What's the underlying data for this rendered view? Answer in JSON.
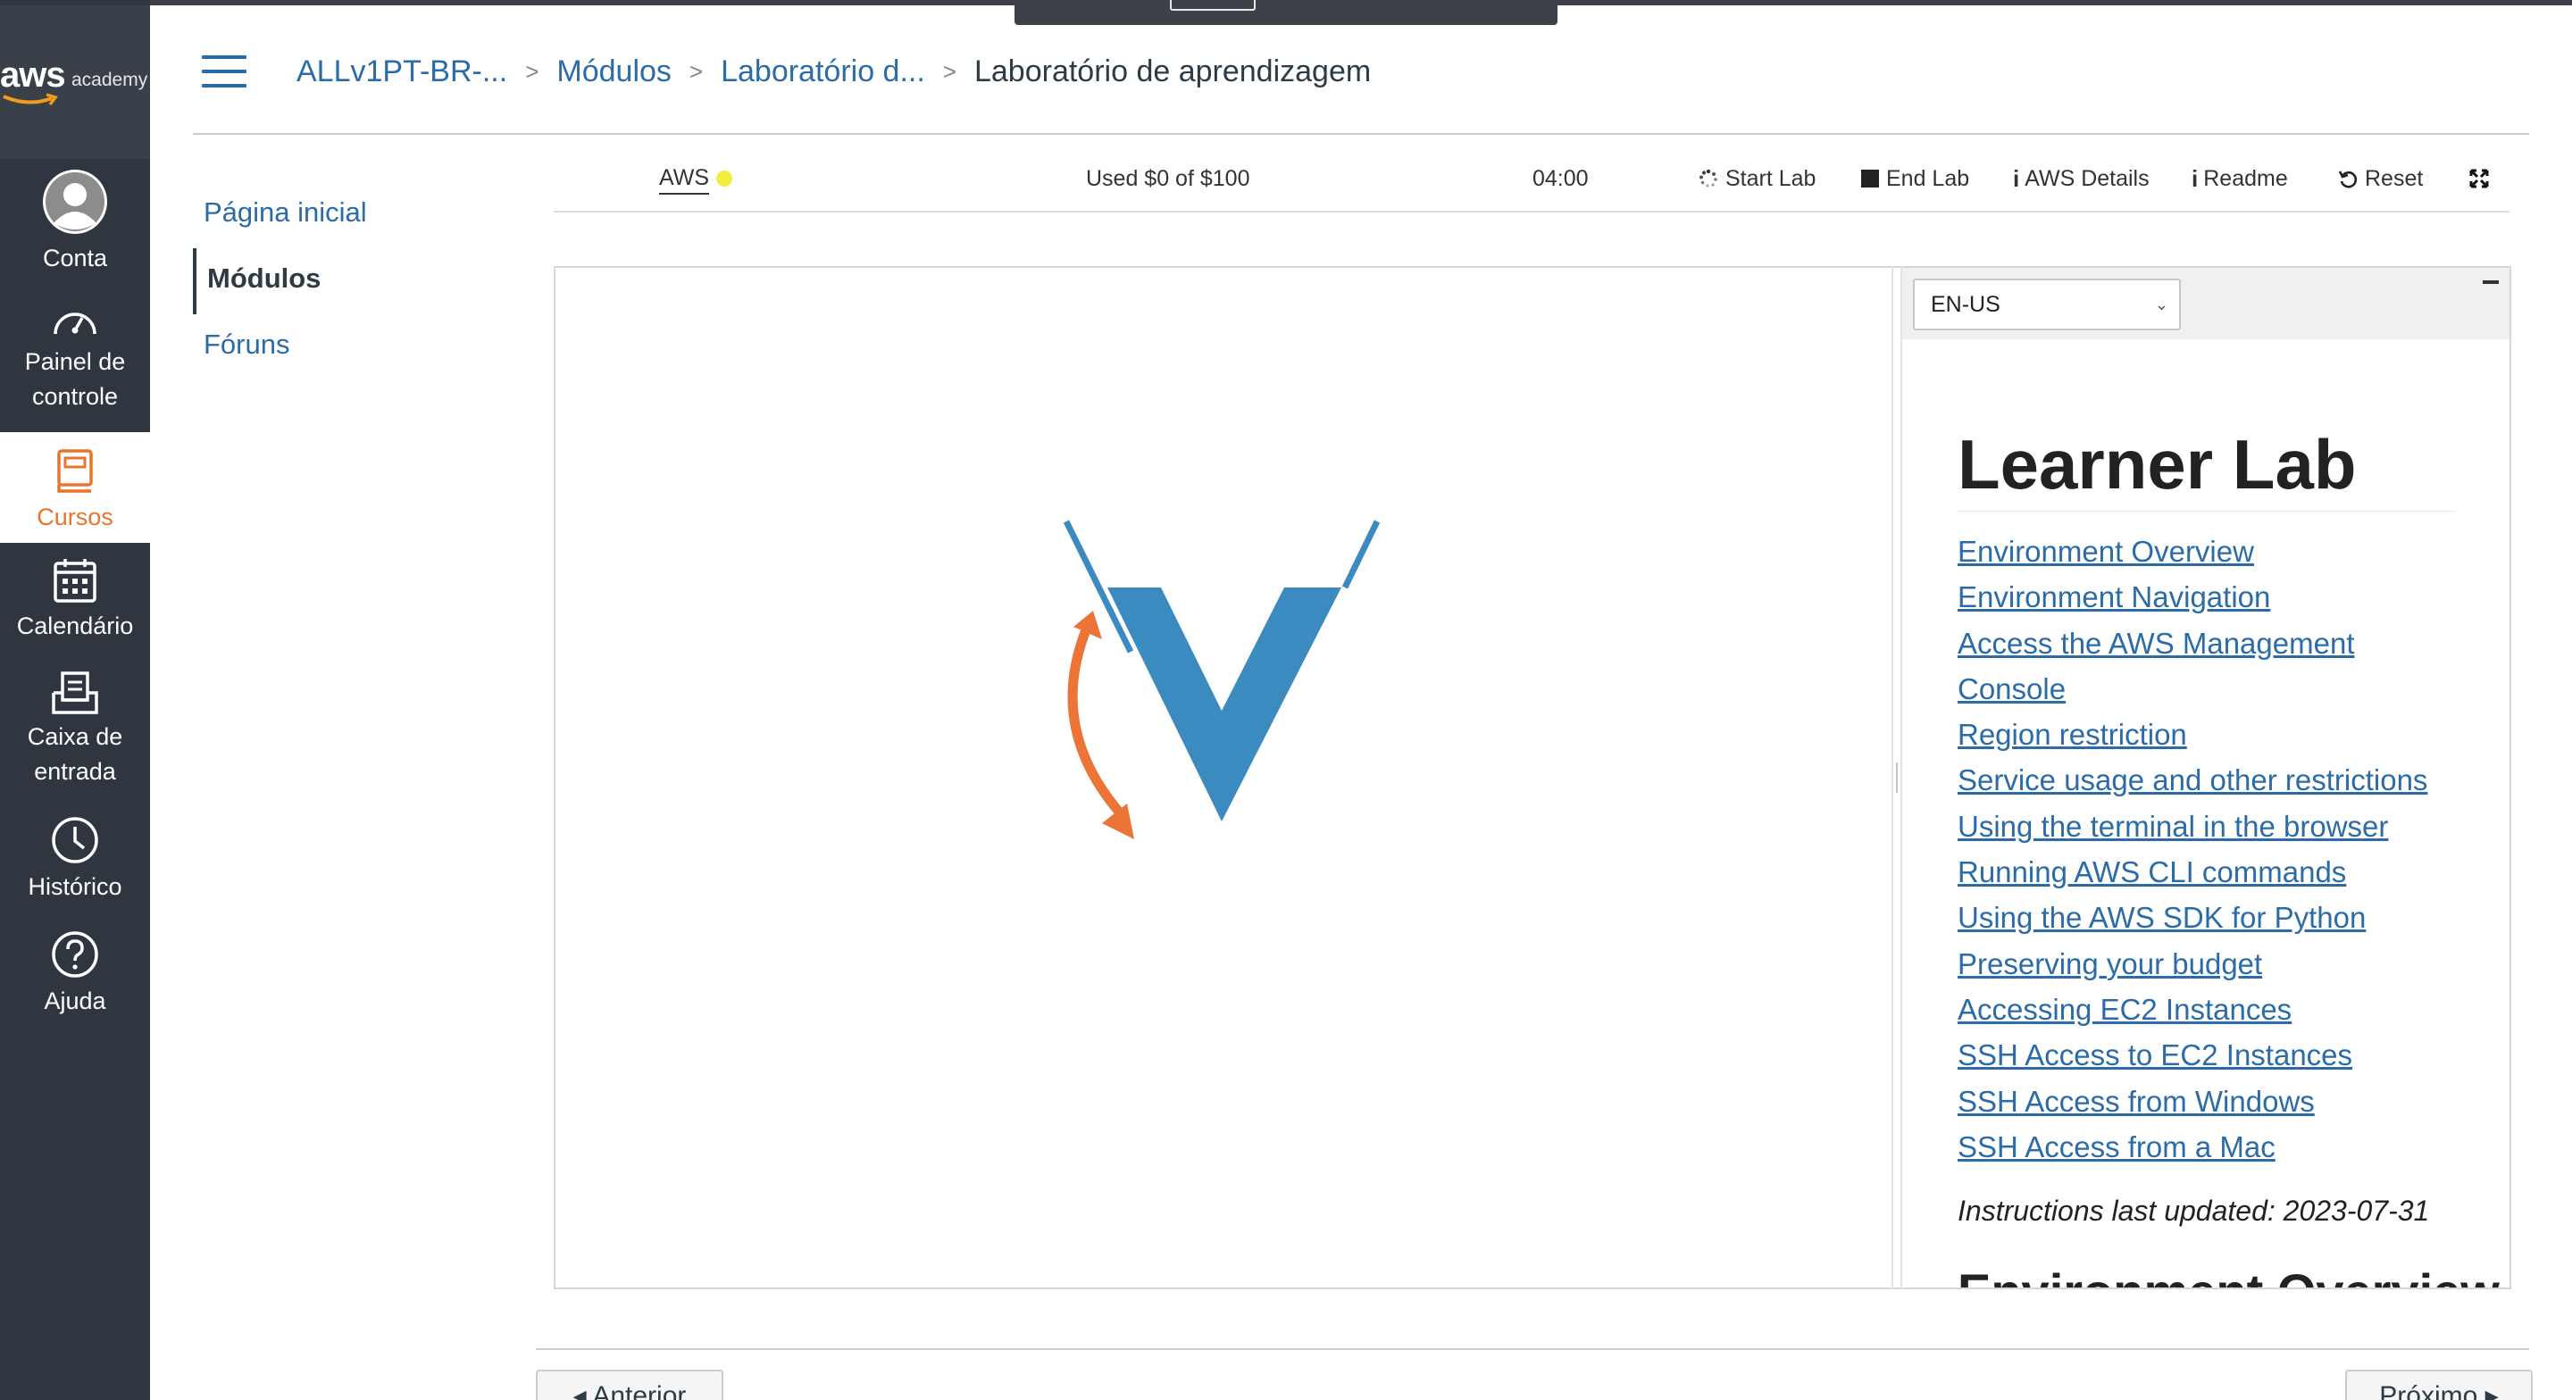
{
  "global_nav": {
    "logo_aws": "aws",
    "logo_academy": "academy",
    "items": [
      {
        "label": "Conta",
        "icon": "account-avatar-icon"
      },
      {
        "label": "Painel de controle",
        "icon": "dashboard-gauge-icon"
      },
      {
        "label": "Cursos",
        "icon": "courses-book-icon",
        "active": true
      },
      {
        "label": "Calendário",
        "icon": "calendar-icon"
      },
      {
        "label": "Caixa de entrada",
        "icon": "inbox-icon"
      },
      {
        "label": "Histórico",
        "icon": "clock-icon"
      },
      {
        "label": "Ajuda",
        "icon": "help-question-icon"
      }
    ],
    "accent_color": "#e9742b"
  },
  "breadcrumb": {
    "items": [
      "ALLv1PT-BR-...",
      "Módulos",
      "Laboratório d..."
    ],
    "current": "Laboratório de aprendizagem"
  },
  "course_nav": {
    "items": [
      {
        "label": "Página inicial",
        "active": false
      },
      {
        "label": "Módulos",
        "active": true
      },
      {
        "label": "Fóruns",
        "active": false
      }
    ]
  },
  "lab_toolbar": {
    "aws_label": "AWS",
    "aws_status_color": "#f1ee3d",
    "budget": "Used $0 of $100",
    "timer": "04:00",
    "start_lab": "Start Lab",
    "end_lab": "End Lab",
    "aws_details": "AWS Details",
    "readme": "Readme",
    "reset": "Reset"
  },
  "readme": {
    "language": "EN-US",
    "title": "Learner Lab",
    "links": [
      "Environment Overview",
      "Environment Navigation",
      "Access the AWS Management",
      "Console",
      "Region restriction",
      "Service usage and other restrictions",
      "Using the terminal in the browser",
      "Running AWS CLI commands",
      "Using the AWS SDK for Python",
      "Preserving your budget",
      "Accessing EC2 Instances",
      "SSH Access to EC2 Instances",
      "SSH Access from Windows",
      "SSH Access from a Mac"
    ],
    "updated": "Instructions last updated: 2023-07-31",
    "next_heading": "Environment Overview"
  },
  "pager": {
    "previous": "◂ Anterior",
    "next": "Próximo ▸"
  },
  "colors": {
    "link": "#2b6ca8",
    "nav_bg": "#2f3640",
    "vocareum_blue": "#3b8bc0",
    "vocareum_orange": "#ec7437"
  }
}
